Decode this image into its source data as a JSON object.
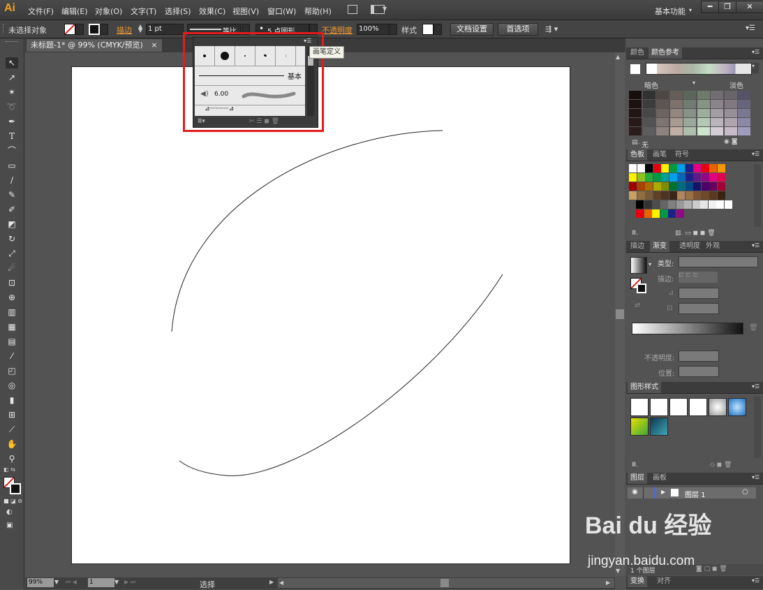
{
  "app": {
    "logo": "Ai",
    "workspace": "基本功能",
    "workspace_arrow": "▾"
  },
  "menu": [
    "文件(F)",
    "编辑(E)",
    "对象(O)",
    "文字(T)",
    "选择(S)",
    "效果(C)",
    "视图(V)",
    "窗口(W)",
    "帮助(H)"
  ],
  "window_buttons": {
    "minimize": "━",
    "restore": "❐",
    "close": "✕"
  },
  "control": {
    "selection": "未选择对象",
    "stroke_label": "描边",
    "stroke_weight": "1 pt",
    "profile": "等比",
    "brush": "5 点圆形",
    "opacity_label": "不透明度",
    "opacity_value": "100%",
    "style_label": "样式",
    "doc_setup": "文档设置",
    "preferences": "首选项"
  },
  "document_tab": {
    "title": "未标题-1* @ 99% (CMYK/预览)",
    "close": "×"
  },
  "brush_popup": {
    "basic_label": "基本",
    "size_value": "6.00",
    "tooltip": "画笔定义"
  },
  "panels": {
    "color_tabs": [
      "颜色",
      "颜色参考"
    ],
    "color_dark": "暗色",
    "color_light": "淡色",
    "color_none": "无",
    "swatch_tabs": [
      "色板",
      "画笔",
      "符号"
    ],
    "gradient_tabs": [
      "描边",
      "渐变",
      "透明度",
      "外观"
    ],
    "gradient_type_label": "类型:",
    "gradient_stroke_label": "描边:",
    "gradient_opacity_label": "不透明度:",
    "gradient_location_label": "位置:",
    "graphic_styles_tab": "图形样式",
    "layers_tabs": [
      "图层",
      "画板"
    ],
    "layer_name": "图层 1",
    "layer_count": "1 个图层",
    "bottom_tabs": [
      "变换",
      "对齐"
    ]
  },
  "status": {
    "zoom": "99%",
    "artboard": "1",
    "mode": "选择"
  },
  "watermark": {
    "brand": "Bai du 经验",
    "url": "jingyan.baidu.com"
  },
  "colors": {
    "accent_red": "#e31b1b",
    "orange": "#f19a2f"
  }
}
